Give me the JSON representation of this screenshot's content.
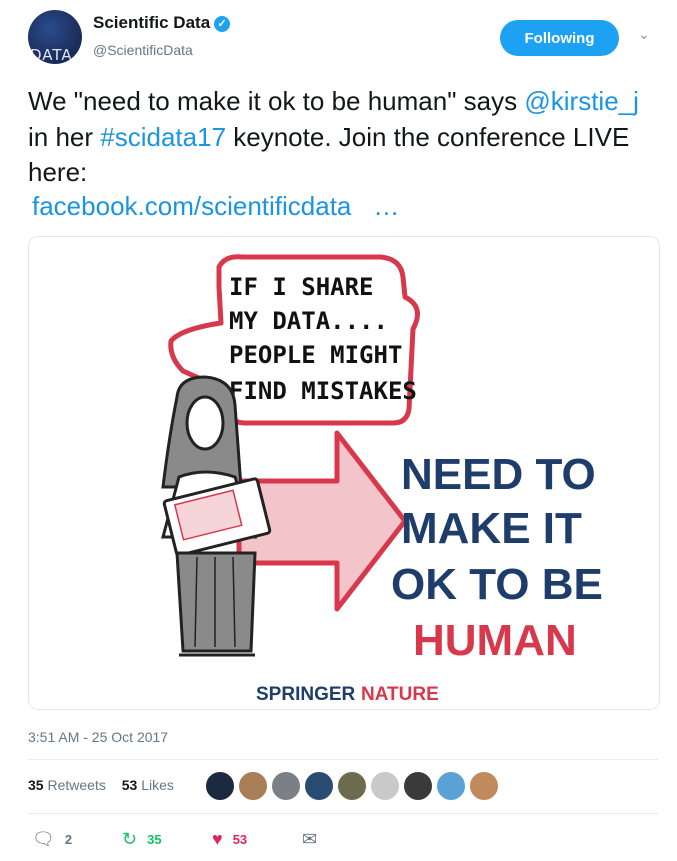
{
  "account": {
    "avatar_text": "DATA",
    "name": "Scientific Data",
    "handle": "@ScientificData",
    "verified_icon": "✓",
    "follow_label": "Following",
    "caret_icon": "⌄"
  },
  "tweet": {
    "text_part1": "We \"need to make it ok to be human\" says ",
    "mention": "@kirstie_j",
    "text_part2": " in her ",
    "hashtag": "#scidata17",
    "text_part3": " keynote. Join the conference LIVE here:",
    "url": "facebook.com/scientificdata",
    "url_ellipsis": "…"
  },
  "image": {
    "bubble_lines": [
      "IF I SHARE",
      "MY DATA....",
      "PEOPLE MIGHT",
      "FIND MISTAKES"
    ],
    "headline_lines": [
      "NEED TO",
      "MAKE IT",
      "OK TO BE"
    ],
    "headline_emphasis": "HUMAN",
    "brand_part1": "SPRINGER",
    "brand_part2": "NATURE"
  },
  "meta": {
    "timestamp": "3:51 AM - 25 Oct 2017",
    "retweets_count": "35",
    "retweets_label": "Retweets",
    "likes_count": "53",
    "likes_label": "Likes"
  },
  "likers": [
    {
      "name": "liker-1",
      "color": "#1b2a3e"
    },
    {
      "name": "liker-2",
      "color": "#a97d55"
    },
    {
      "name": "liker-3",
      "color": "#7b7f86"
    },
    {
      "name": "liker-4",
      "color": "#2a4c73"
    },
    {
      "name": "liker-5",
      "color": "#6d6b4e"
    },
    {
      "name": "liker-6",
      "color": "#c9c9c9"
    },
    {
      "name": "liker-7",
      "color": "#3a3a3a"
    },
    {
      "name": "liker-8",
      "color": "#5aa1d6"
    },
    {
      "name": "liker-9",
      "color": "#c08a5c"
    }
  ],
  "actions": {
    "reply_count": "2",
    "retweet_count": "35",
    "like_count": "53"
  },
  "colors": {
    "brand_blue": "#1da1f2",
    "link_blue": "#1b95e0",
    "retweet_green": "#17bf63",
    "like_red": "#e0245e",
    "muted": "#657786",
    "illustration_red": "#d8384b",
    "illustration_navy": "#1f3d6b"
  }
}
